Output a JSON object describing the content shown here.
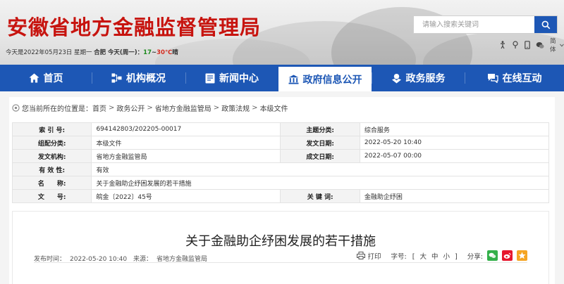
{
  "header": {
    "site_title": "安徽省地方金融监督管理局",
    "search_placeholder": "请输入搜索关键词",
    "date_prefix": "今天是2022年05月23日 星期一 ",
    "city": "合肥",
    "weather_label": "今天(周一)：",
    "temp_low": "17",
    "temp_sep": "~",
    "temp_high": "30℃",
    "weather": "晴",
    "tools": {
      "accessibility_label": "",
      "lang_label": "简体"
    }
  },
  "nav": {
    "items": [
      {
        "label": "首页",
        "icon": "home-icon"
      },
      {
        "label": "机构概况",
        "icon": "org-chart-icon"
      },
      {
        "label": "新闻中心",
        "icon": "news-icon"
      },
      {
        "label": "政府信息公开",
        "icon": "building-icon",
        "active": true
      },
      {
        "label": "政务服务",
        "icon": "service-icon"
      },
      {
        "label": "在线互动",
        "icon": "chat-icon"
      }
    ]
  },
  "breadcrumb": {
    "prefix": "您当前所在的位置是：",
    "items": [
      "首页",
      "政务公开",
      "省地方金融监管局",
      "政策法规",
      "本级文件"
    ]
  },
  "meta": {
    "index_label": "索 引 号:",
    "index_value": "694142803/202205-00017",
    "topic_label": "主题分类:",
    "topic_value": "综合服务",
    "form_label": "组配分类:",
    "form_value": "本级文件",
    "pubdate_label": "发文日期:",
    "pubdate_value": "2022-05-20 10:40",
    "org_label": "发文机构:",
    "org_value": "省地方金融监管局",
    "created_label": "成文日期:",
    "created_value": "2022-05-07 00:00",
    "validity_label": "有 效 性:",
    "validity_value": "有效",
    "name_label": "名　　称:",
    "name_value": "关于金融助企纾困发展的若干措施",
    "doc_label": "文　　号:",
    "doc_value": "皖金〔2022〕45号",
    "keyword_label": "关 键 词:",
    "keyword_value": "金融助企纾困"
  },
  "article": {
    "title": "关于金融助企纾困发展的若干措施",
    "pub_time_label": "发布时间：",
    "pub_time": "2022-05-20 10:40",
    "source_label": "来源：",
    "source": "省地方金融监管局",
    "print_label": "打印",
    "font_label": "字号:",
    "font_open": "[",
    "font_large": "大",
    "font_medium": "中",
    "font_small": "小",
    "font_close": "]",
    "share_label": "分享:"
  },
  "colors": {
    "brand_blue": "#1d57b5",
    "title_red": "#c7140f"
  }
}
